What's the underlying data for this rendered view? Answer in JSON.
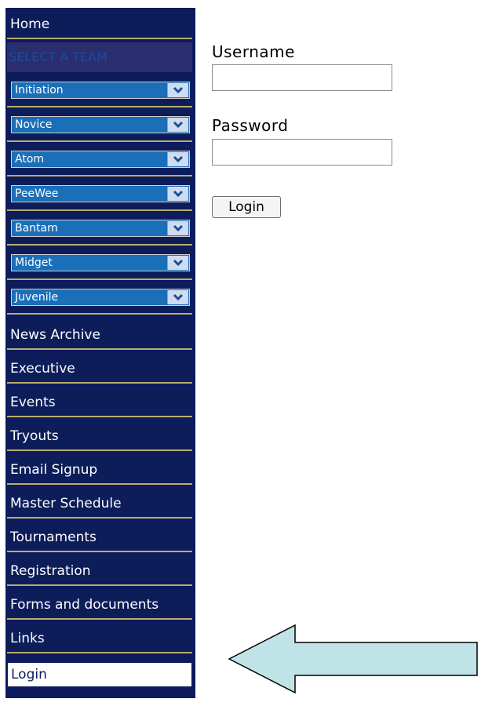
{
  "sidebar": {
    "home": "Home",
    "select_team_header": "SELECT A TEAM",
    "teams": [
      "Initiation",
      "Novice",
      "Atom",
      "PeeWee",
      "Bantam",
      "Midget",
      "Juvenile"
    ],
    "menu": [
      "News Archive",
      "Executive",
      "Events",
      "Tryouts",
      "Email Signup",
      "Master Schedule",
      "Tournaments",
      "Registration",
      "Forms and documents",
      "Links"
    ],
    "active_item": "Login"
  },
  "login_form": {
    "username_label": "Username",
    "username_value": "",
    "password_label": "Password",
    "password_value": "",
    "submit_label": "Login"
  },
  "colors": {
    "sidebar_bg": "#0c1d5a",
    "divider": "#b9ad6b",
    "select_bg": "#1a6fb8",
    "arrow_fill": "#bfe3e6"
  }
}
